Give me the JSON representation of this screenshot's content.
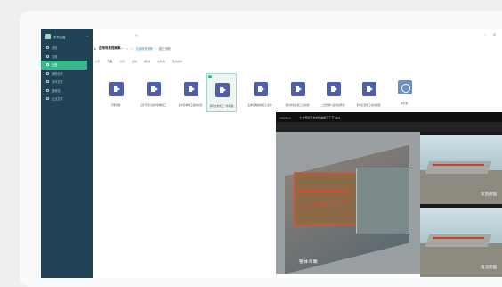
{
  "sidebar": {
    "brand": "东华云盘",
    "items": [
      {
        "label": "首页",
        "active": false
      },
      {
        "label": "文档",
        "active": false
      },
      {
        "label": "云盘",
        "active": true
      },
      {
        "label": "我的分享",
        "active": false
      },
      {
        "label": "协作文件",
        "active": false
      },
      {
        "label": "回收站",
        "active": false
      },
      {
        "label": "企业文件",
        "active": false
      }
    ]
  },
  "window": {
    "tab_close": "×",
    "controls": "○ ⊕"
  },
  "breadcrumb": {
    "title": "应用场景视频库...",
    "nav": "‹ ›",
    "refresh": "C",
    "path1": "应用场景视频",
    "path2": "施工视频"
  },
  "toolbar": {
    "items": [
      "上传",
      "下载",
      "分享",
      "复制",
      "删除",
      "重命名",
      "更多操作"
    ]
  },
  "files": [
    {
      "name": "万能视频...",
      "type": "video",
      "selected": false
    },
    {
      "name": "土方开挖与支护结构施工...",
      "type": "video",
      "selected": false
    },
    {
      "name": "主体结构施工模拟动画...",
      "type": "video",
      "selected": false
    },
    {
      "name": "基坑支护施工一体化模...",
      "type": "video",
      "selected": true
    },
    {
      "name": "主体结构模拟施工演示...",
      "type": "video",
      "selected": false
    },
    {
      "name": "钢结构安装施工动画视...",
      "type": "video",
      "selected": false
    },
    {
      "name": "二次结构与装饰装修施...",
      "type": "video",
      "selected": false
    },
    {
      "name": "机电安装施工动画视频...",
      "type": "video",
      "selected": false
    },
    {
      "name": "总平面...",
      "type": "pdf",
      "selected": false
    }
  ],
  "player": {
    "app": "Vodplayer",
    "sep": "·",
    "video_title": "土方开挖与支护结构施工工艺.mp4",
    "main_caption": "整体鸟瞰",
    "thumbs": [
      {
        "caption": "东西侧面"
      },
      {
        "caption": "南北侧面"
      }
    ]
  },
  "colors": {
    "sidebar": "#1f4354",
    "accent": "#37b98e",
    "video_icon": "#4f5fa8"
  }
}
